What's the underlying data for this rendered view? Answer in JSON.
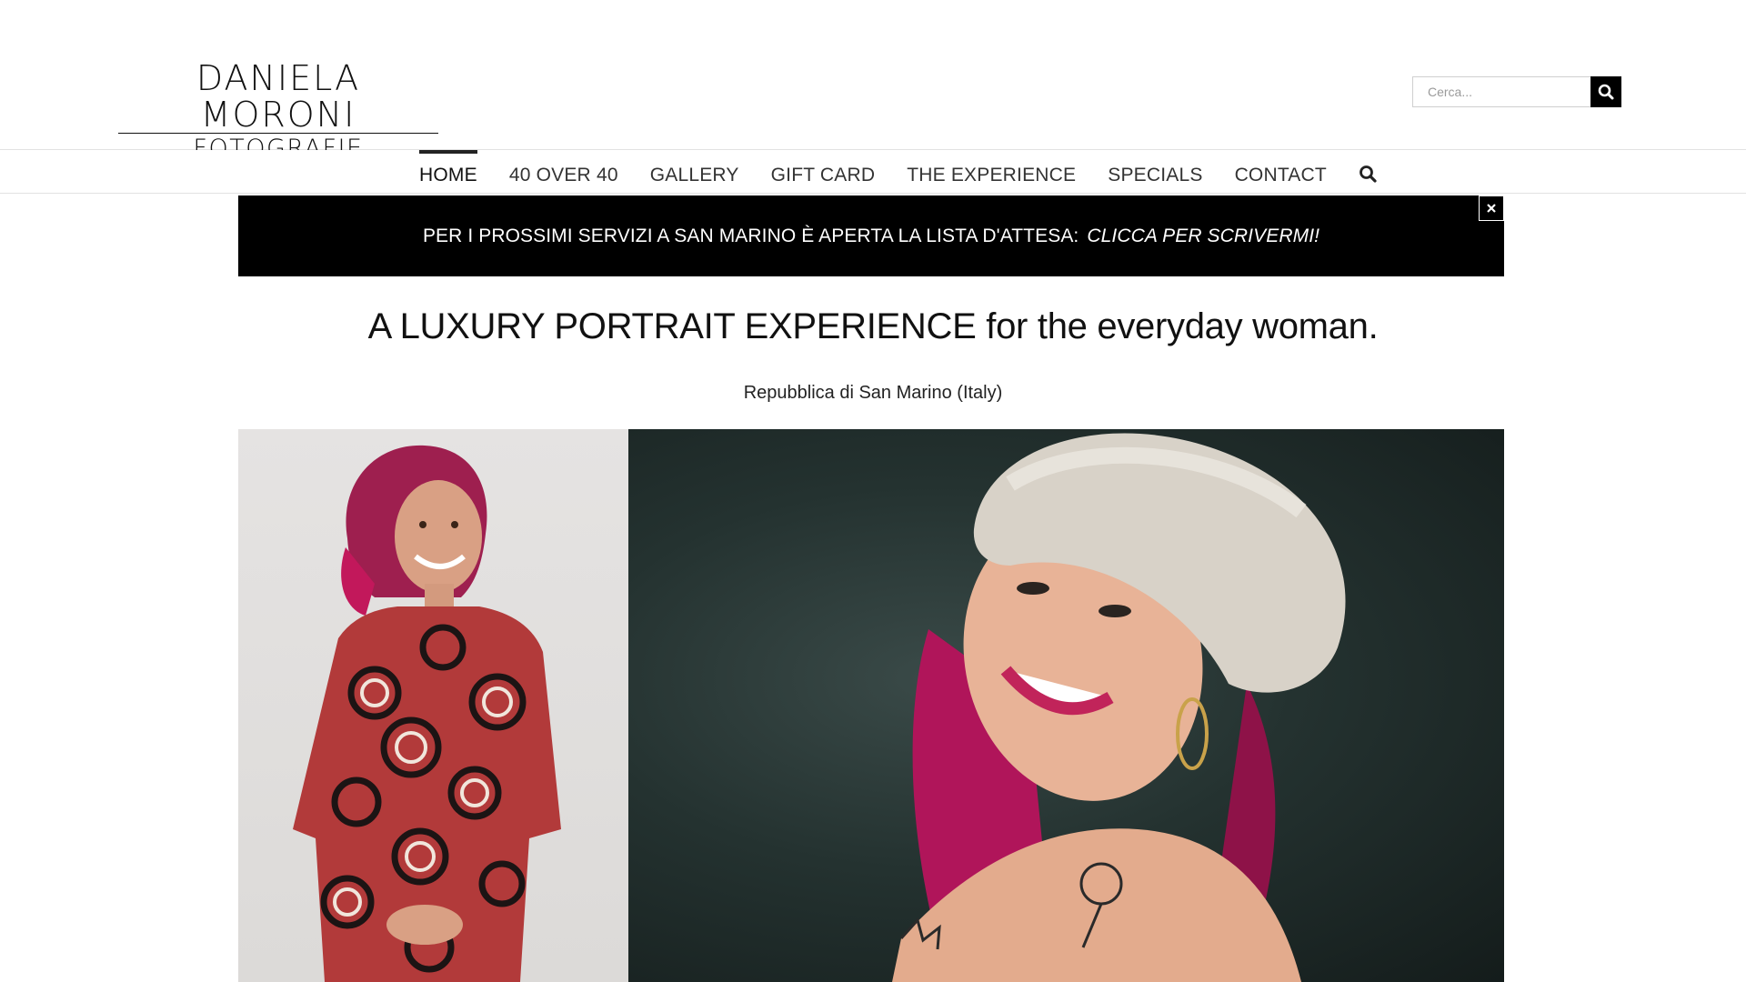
{
  "brand": {
    "name_top": "DANIELA MORONI",
    "name_bottom": "FOTOGRAFIE"
  },
  "search": {
    "placeholder": "Cerca...",
    "icon": "search-icon"
  },
  "nav": {
    "items": [
      {
        "label": "HOME",
        "active": true
      },
      {
        "label": "40 OVER 40",
        "active": false
      },
      {
        "label": "GALLERY",
        "active": false
      },
      {
        "label": "GIFT CARD",
        "active": false
      },
      {
        "label": "THE EXPERIENCE",
        "active": false
      },
      {
        "label": "SPECIALS",
        "active": false
      },
      {
        "label": "CONTACT",
        "active": false
      }
    ],
    "search_icon": "search-icon"
  },
  "banner": {
    "text": "PER I PROSSIMI SERVIZI A SAN MARINO È APERTA LA LISTA D'ATTESA:",
    "link": "CLICCA PER SCRIVERMI!",
    "close_icon": "close-icon"
  },
  "hero": {
    "headline": "A LUXURY PORTRAIT EXPERIENCE for the everyday woman.",
    "subline": "Repubblica di San Marino (Italy)"
  },
  "colors": {
    "banner_bg": "#000000",
    "text": "#111111",
    "nav_text": "#333333",
    "accent_hair": "#c2185b"
  }
}
